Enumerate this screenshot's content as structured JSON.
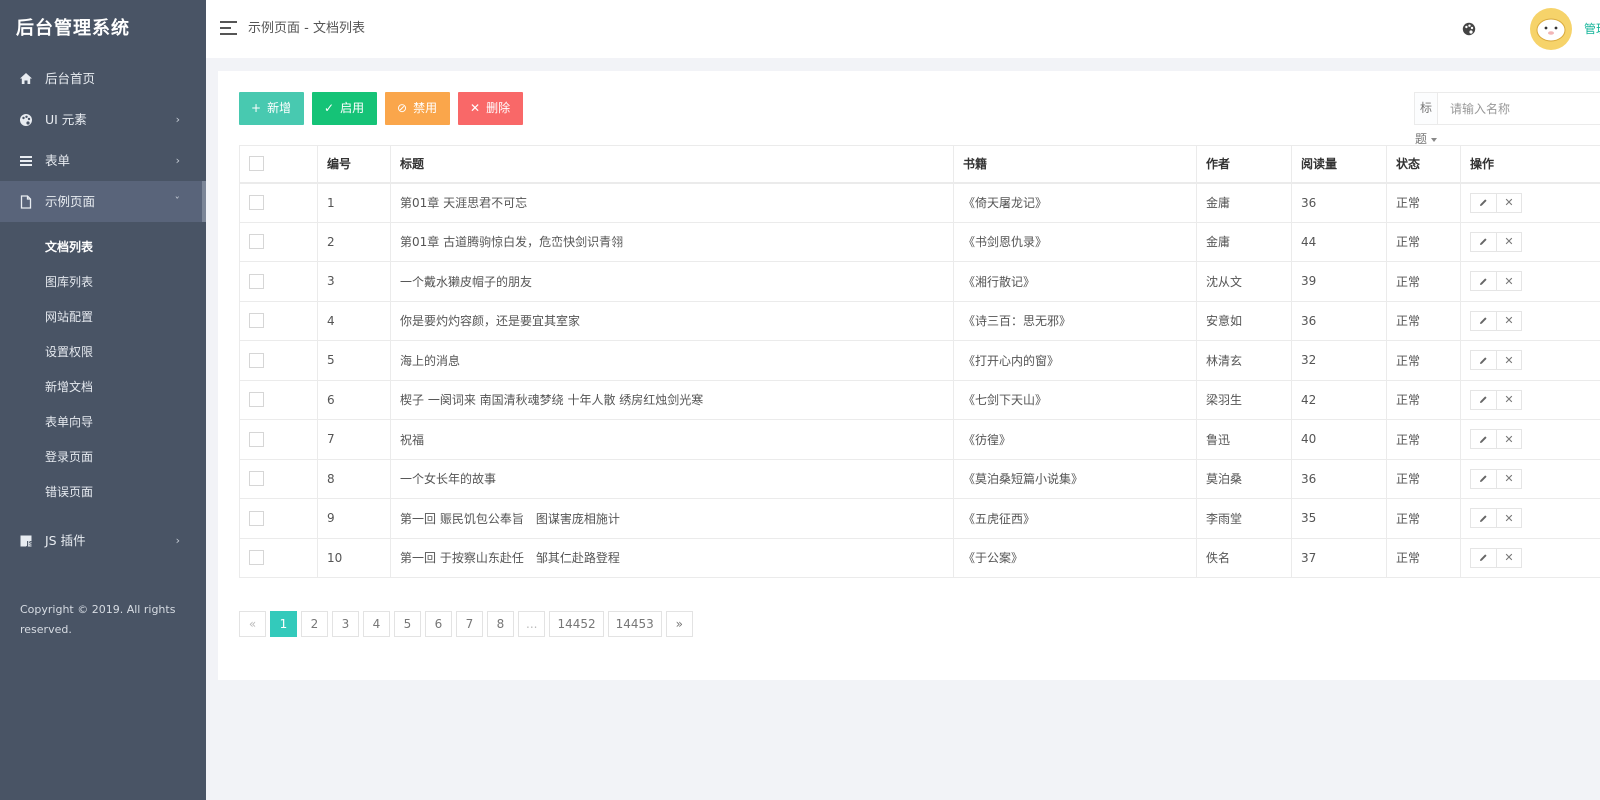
{
  "app": {
    "title": "后台管理系统"
  },
  "sidebar": {
    "items": [
      {
        "label": "后台首页",
        "icon": "home-icon"
      },
      {
        "label": "UI 元素",
        "icon": "palette-icon"
      },
      {
        "label": "表单",
        "icon": "list-icon"
      },
      {
        "label": "示例页面",
        "icon": "file-icon"
      },
      {
        "label": "JS 插件",
        "icon": "js-icon"
      }
    ],
    "submenu": [
      {
        "label": "文档列表"
      },
      {
        "label": "图库列表"
      },
      {
        "label": "网站配置"
      },
      {
        "label": "设置权限"
      },
      {
        "label": "新增文档"
      },
      {
        "label": "表单向导"
      },
      {
        "label": "登录页面"
      },
      {
        "label": "错误页面"
      }
    ],
    "copyright": "Copyright © 2019. All rights reserved."
  },
  "header": {
    "breadcrumb": "示例页面 - 文档列表",
    "user_name": "管理员"
  },
  "toolbar": {
    "add_label": "新增",
    "enable_label": "启用",
    "disable_label": "禁用",
    "delete_label": "删除"
  },
  "search": {
    "type_label": "标题",
    "placeholder": "请输入名称"
  },
  "table": {
    "headers": {
      "id": "编号",
      "title": "标题",
      "book": "书籍",
      "author": "作者",
      "reads": "阅读量",
      "status": "状态",
      "actions": "操作"
    },
    "rows": [
      {
        "id": "1",
        "title": "第01章 天涯思君不可忘",
        "book": "《倚天屠龙记》",
        "author": "金庸",
        "reads": "36",
        "status": "正常"
      },
      {
        "id": "2",
        "title": "第01章 古道腾驹惊白发，危峦快剑识青翎",
        "book": "《书剑恩仇录》",
        "author": "金庸",
        "reads": "44",
        "status": "正常"
      },
      {
        "id": "3",
        "title": "一个戴水獭皮帽子的朋友",
        "book": "《湘行散记》",
        "author": "沈从文",
        "reads": "39",
        "status": "正常"
      },
      {
        "id": "4",
        "title": "你是要灼灼容颜，还是要宜其室家",
        "book": "《诗三百：思无邪》",
        "author": "安意如",
        "reads": "36",
        "status": "正常"
      },
      {
        "id": "5",
        "title": "海上的消息",
        "book": "《打开心内的窗》",
        "author": "林清玄",
        "reads": "32",
        "status": "正常"
      },
      {
        "id": "6",
        "title": "楔子 一阕词来 南国清秋魂梦绕 十年人散 绣房红烛剑光寒",
        "book": "《七剑下天山》",
        "author": "梁羽生",
        "reads": "42",
        "status": "正常"
      },
      {
        "id": "7",
        "title": "祝福",
        "book": "《彷徨》",
        "author": "鲁迅",
        "reads": "40",
        "status": "正常"
      },
      {
        "id": "8",
        "title": "一个女长年的故事",
        "book": "《莫泊桑短篇小说集》",
        "author": "莫泊桑",
        "reads": "36",
        "status": "正常"
      },
      {
        "id": "9",
        "title": "第一回 赈民饥包公奉旨　图谋害庞相施计",
        "book": "《五虎征西》",
        "author": "李雨堂",
        "reads": "35",
        "status": "正常"
      },
      {
        "id": "10",
        "title": "第一回 于按察山东赴任　邹其仁赴路登程",
        "book": "《于公案》",
        "author": "佚名",
        "reads": "37",
        "status": "正常"
      }
    ]
  },
  "pagination": {
    "prev": "«",
    "next": "»",
    "pages": [
      "1",
      "2",
      "3",
      "4",
      "5",
      "6",
      "7",
      "8",
      "...",
      "14452",
      "14453"
    ],
    "current": "1"
  },
  "colors": {
    "sidebar_bg": "#495465",
    "accent": "#33cabb",
    "success": "#15c377",
    "warning": "#faa64b",
    "danger": "#f96868"
  }
}
